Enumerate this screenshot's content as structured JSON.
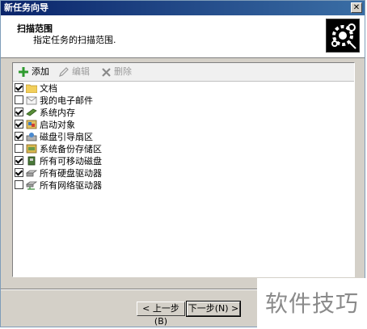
{
  "window": {
    "title": "新任务向导",
    "close_glyph": "✕"
  },
  "header": {
    "title": "扫描范围",
    "subtitle": "指定任务的扫描范围."
  },
  "toolbar": {
    "add_label": "添加",
    "edit_label": "编辑",
    "delete_label": "删除"
  },
  "items": [
    {
      "label": "文档",
      "checked": true,
      "icon": "folder-icon"
    },
    {
      "label": "我的电子邮件",
      "checked": false,
      "icon": "mail-icon"
    },
    {
      "label": "系统内存",
      "checked": true,
      "icon": "memory-icon"
    },
    {
      "label": "启动对象",
      "checked": true,
      "icon": "startup-icon"
    },
    {
      "label": "磁盘引导扇区",
      "checked": true,
      "icon": "boot-sector-icon"
    },
    {
      "label": "系统备份存储区",
      "checked": false,
      "icon": "backup-icon"
    },
    {
      "label": "所有可移动磁盘",
      "checked": true,
      "icon": "removable-disk-icon"
    },
    {
      "label": "所有硬盘驱动器",
      "checked": true,
      "icon": "hard-drive-icon"
    },
    {
      "label": "所有网络驱动器",
      "checked": false,
      "icon": "network-drive-icon"
    }
  ],
  "footer": {
    "back_label": "< 上一步(B)",
    "next_label": "下一步(N) >"
  },
  "watermark": {
    "text": "软件技巧"
  }
}
